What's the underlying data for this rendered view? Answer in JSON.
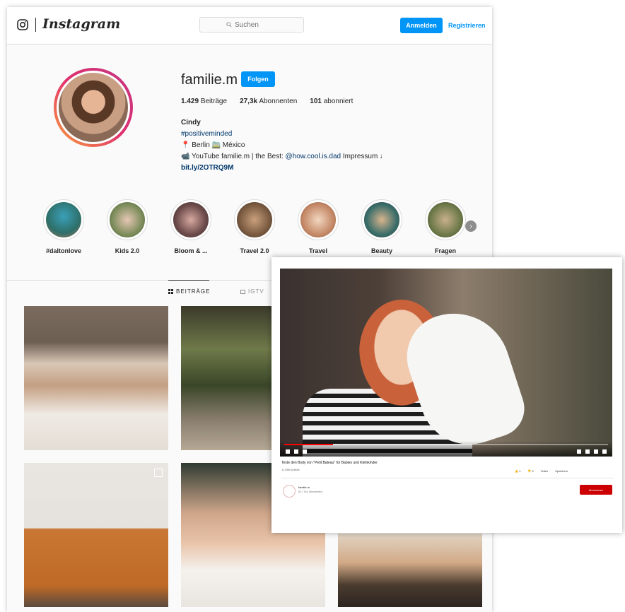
{
  "instagram": {
    "wordmark": "Instagram",
    "search_placeholder": "Suchen",
    "login_label": "Anmelden",
    "register_label": "Registrieren",
    "profile": {
      "username": "familie.m",
      "follow_label": "Folgen",
      "posts_count": "1.429",
      "posts_label": "Beiträge",
      "followers_count": "27,3k",
      "followers_label": "Abonnenten",
      "following_count": "101",
      "following_label": "abonniert",
      "bio_name": "Cindy",
      "bio_hashtag": "#positiveminded",
      "bio_location": "📍 Berlin 🚞 México",
      "bio_youtube_prefix": "📹 YouTube familie.m | the Best: ",
      "bio_youtube_handle": "@how.cool.is.dad",
      "bio_youtube_suffix": " Impressum ♩",
      "bio_link": "bit.ly/2OTRQ9M"
    },
    "highlights": [
      {
        "label": "#daltonlove"
      },
      {
        "label": "Kids 2.0"
      },
      {
        "label": "Bloom & ..."
      },
      {
        "label": "Travel 2.0"
      },
      {
        "label": "Travel"
      },
      {
        "label": "Beauty"
      },
      {
        "label": "Fragen"
      }
    ],
    "tabs": {
      "posts": "BEITRÄGE",
      "igtv": "IGTV"
    }
  },
  "youtube": {
    "video_title": "Teste den Body von \"Petit Bateau\" für Babies und Kleinkinder",
    "views": "11.586 Aufrufe",
    "progress": 0.15,
    "actions": [
      "👍 1",
      "👎 0",
      "Teilen",
      "Speichern"
    ],
    "channel_name": "familie.m",
    "channel_subs": "53.7 Tsd. Abonnenten",
    "subscribe_label": "Abonnieren"
  }
}
